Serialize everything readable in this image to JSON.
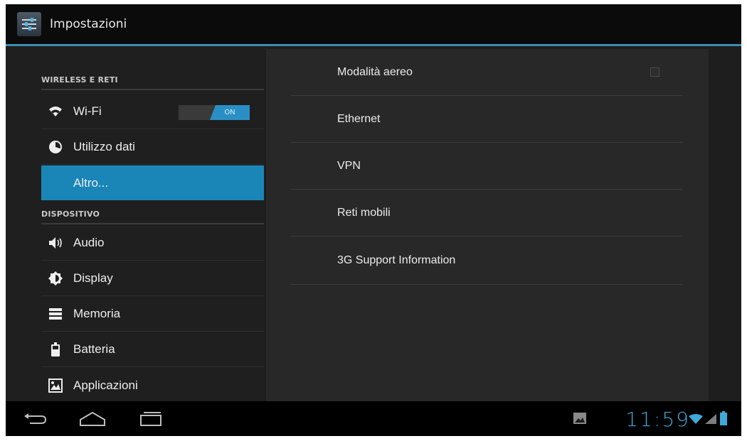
{
  "actionbar": {
    "title": "Impostazioni",
    "icon": "settings-sliders-icon"
  },
  "left_pane": {
    "sections": [
      {
        "header": "WIRELESS E RETI",
        "items": [
          {
            "label": "Wi-Fi",
            "icon": "wifi-icon",
            "toggle": "ON"
          },
          {
            "label": "Utilizzo dati",
            "icon": "data-usage-icon"
          },
          {
            "label": "Altro...",
            "icon": "",
            "selected": true
          }
        ]
      },
      {
        "header": "DISPOSITIVO",
        "items": [
          {
            "label": "Audio",
            "icon": "speaker-icon"
          },
          {
            "label": "Display",
            "icon": "brightness-icon"
          },
          {
            "label": "Memoria",
            "icon": "storage-icon"
          },
          {
            "label": "Batteria",
            "icon": "battery-icon"
          },
          {
            "label": "Applicazioni",
            "icon": "apps-icon"
          }
        ]
      }
    ]
  },
  "right_pane": {
    "items": [
      {
        "label": "Modalità aereo",
        "checkbox": false
      },
      {
        "label": "Ethernet"
      },
      {
        "label": "VPN"
      },
      {
        "label": "Reti mobili"
      },
      {
        "label": "3G Support Information"
      }
    ]
  },
  "navbar": {
    "buttons": [
      "back-icon",
      "home-icon",
      "recent-apps-icon"
    ],
    "clock": "11:59",
    "status_icons": [
      "gallery-notification-icon",
      "wifi-signal-icon",
      "cell-signal-icon",
      "battery-status-icon"
    ]
  },
  "colors": {
    "accent": "#1a86b8",
    "clock": "#3fa9d8",
    "background": "#1e1e1e"
  }
}
